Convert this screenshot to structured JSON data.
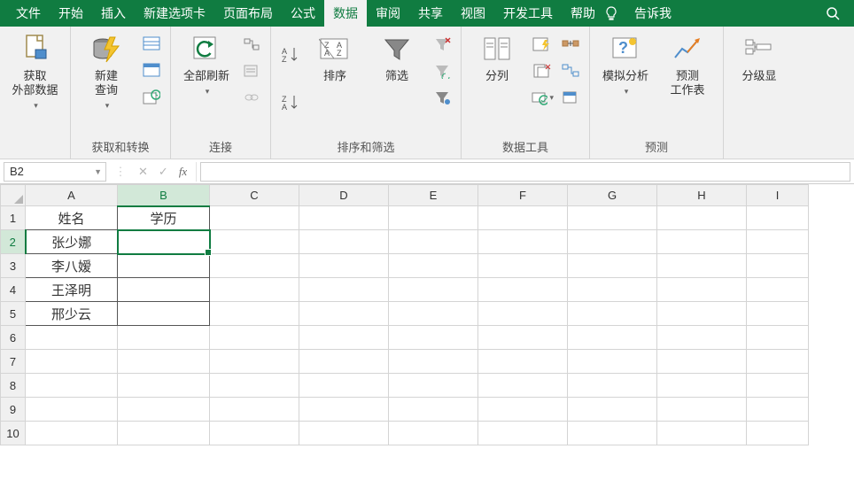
{
  "menu": {
    "tabs": [
      "文件",
      "开始",
      "插入",
      "新建选项卡",
      "页面布局",
      "公式",
      "数据",
      "审阅",
      "共享",
      "视图",
      "开发工具",
      "帮助"
    ],
    "active_index": 6,
    "tell_me": "告诉我"
  },
  "ribbon": {
    "groups": [
      {
        "label": "",
        "buttons": [
          {
            "name": "get-external-data",
            "label": "获取\n外部数据"
          }
        ]
      },
      {
        "label": "获取和转换",
        "buttons": [
          {
            "name": "new-query",
            "label": "新建\n查询"
          }
        ]
      },
      {
        "label": "连接",
        "buttons": [
          {
            "name": "refresh-all",
            "label": "全部刷新"
          }
        ]
      },
      {
        "label": "排序和筛选",
        "buttons": [
          {
            "name": "sort",
            "label": "排序"
          },
          {
            "name": "filter",
            "label": "筛选"
          }
        ]
      },
      {
        "label": "数据工具",
        "buttons": [
          {
            "name": "text-to-columns",
            "label": "分列"
          }
        ]
      },
      {
        "label": "预测",
        "buttons": [
          {
            "name": "whatif",
            "label": "模拟分析"
          },
          {
            "name": "forecast",
            "label": "预测\n工作表"
          }
        ]
      },
      {
        "label": "",
        "buttons": [
          {
            "name": "outline",
            "label": "分级显"
          }
        ]
      }
    ]
  },
  "formula_bar": {
    "name_box": "B2",
    "fx_label": "fx",
    "formula_value": ""
  },
  "sheet": {
    "columns": [
      "A",
      "B",
      "C",
      "D",
      "E",
      "F",
      "G",
      "H",
      "I"
    ],
    "selected_col": "B",
    "selected_row": 2,
    "row_count": 10,
    "cells": {
      "A1": "姓名",
      "B1": "学历",
      "A2": "张少娜",
      "A3": "李八嫒",
      "A4": "王泽明",
      "A5": "邢少云"
    },
    "bordered_range": {
      "r1": 1,
      "c1": "A",
      "r2": 5,
      "c2": "B"
    }
  }
}
